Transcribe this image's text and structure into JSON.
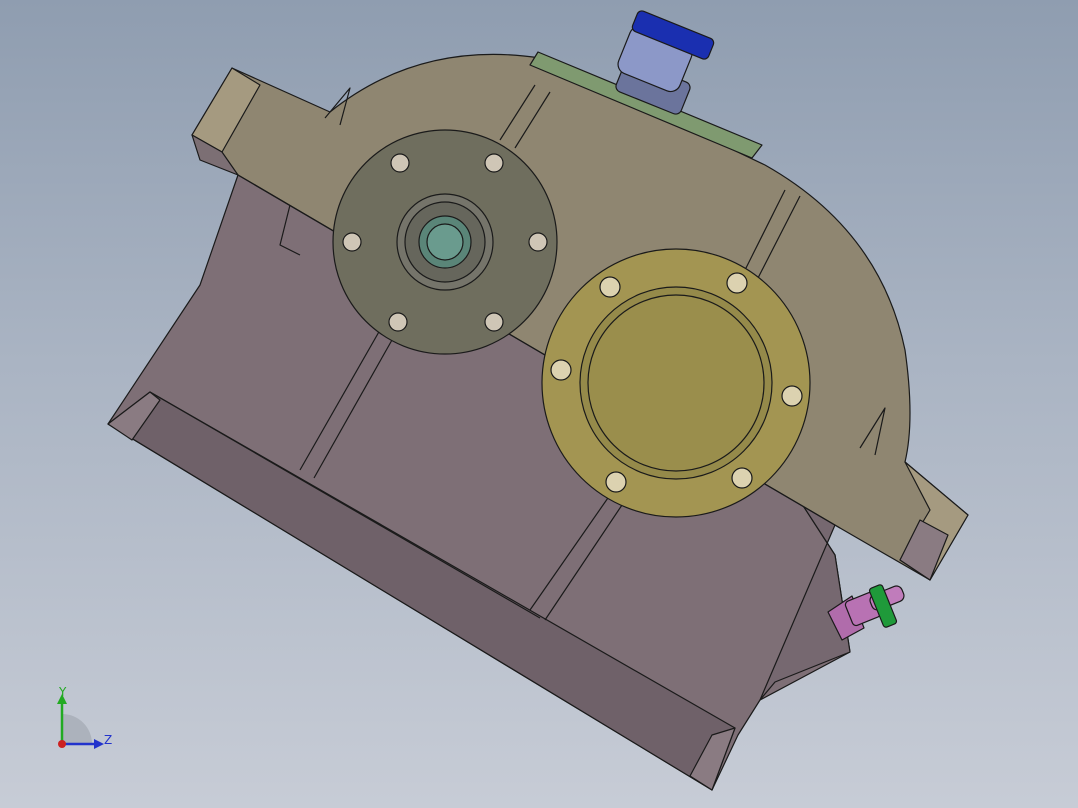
{
  "viewport": {
    "model": "gearbox-housing-assembly",
    "colors": {
      "background_top": "#8f9db0",
      "background_bottom": "#c7ccd6",
      "lower_housing": "#7e6f76",
      "upper_cover": "#8f8671",
      "left_bearing_cap": "#6f6e5e",
      "right_bearing_cap": "#a39552",
      "breather_cap": "#1a2fb0",
      "breather_body": "#8c98c8",
      "inspection_plate": "#7f9a70",
      "drain_plug": "#b06cab",
      "drain_plug_ring": "#1f9a3a",
      "edge": "#1a1a1a"
    }
  },
  "axis_triad": {
    "y_label": "Y",
    "z_label": "Z",
    "y_color": "#22aa22",
    "z_color": "#2233cc",
    "x_color": "#cc2222"
  }
}
